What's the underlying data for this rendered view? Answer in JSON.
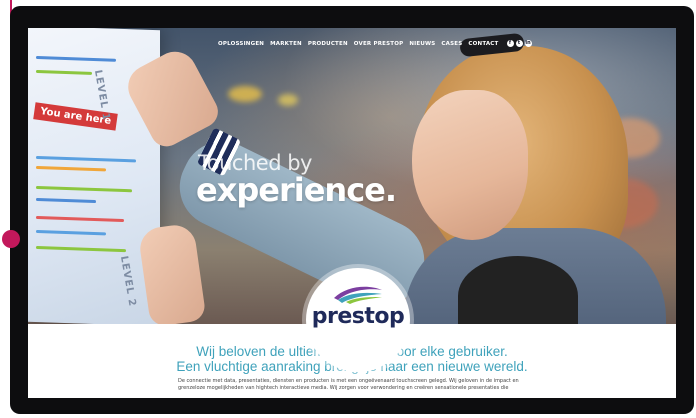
{
  "nav": {
    "items": [
      "OPLOSSINGEN",
      "MARKTEN",
      "PRODUCTEN",
      "OVER PRESTOP",
      "NIEUWS",
      "CASES",
      "CONTACT"
    ],
    "social_icons": [
      "facebook-icon",
      "twitter-icon",
      "linkedin-icon"
    ]
  },
  "hero": {
    "headline_light": "Touched by",
    "headline_bold": "experience.",
    "wall_sign": "You are here",
    "wall_levels": [
      "LEVEL 1",
      "LEVEL 2"
    ]
  },
  "logo": {
    "text": "prestop",
    "colors": [
      "#7c3fa0",
      "#3fa2bb",
      "#8cc63f"
    ]
  },
  "content": {
    "tagline_line1": "Wij beloven de ultieme beleving voor elke gebruiker.",
    "tagline_line2": "Een vluchtige aanraking brengt je naar een nieuwe wereld.",
    "body": "De connectie met data, presentaties, diensten en producten is met een ongeëvenaard touchscreen gelegd. Wij geloven in de impact en grenzeloze mogelijkheden van hightech interactieve media. Wij zorgen voor verwondering en creëren sensationele presentaties die"
  },
  "colors": {
    "accent": "#3fa2bb",
    "brand_navy": "#1f2a5a",
    "annotation": "#c2185b"
  }
}
